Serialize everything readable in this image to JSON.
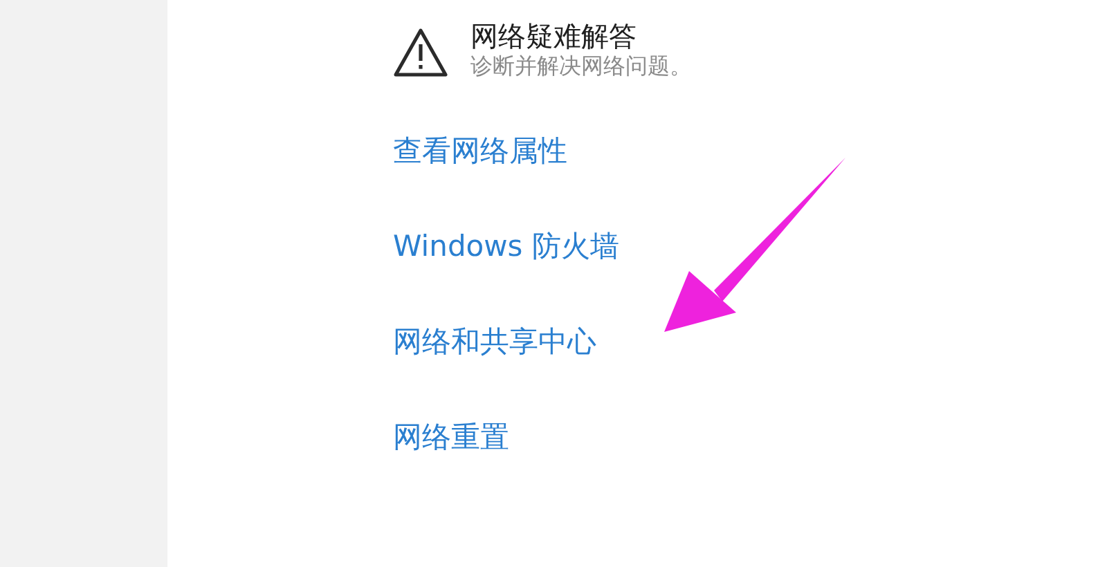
{
  "troubleshoot": {
    "title": "网络疑难解答",
    "description": "诊断并解决网络问题。"
  },
  "links": [
    "查看网络属性",
    "Windows 防火墙",
    "网络和共享中心",
    "网络重置"
  ]
}
